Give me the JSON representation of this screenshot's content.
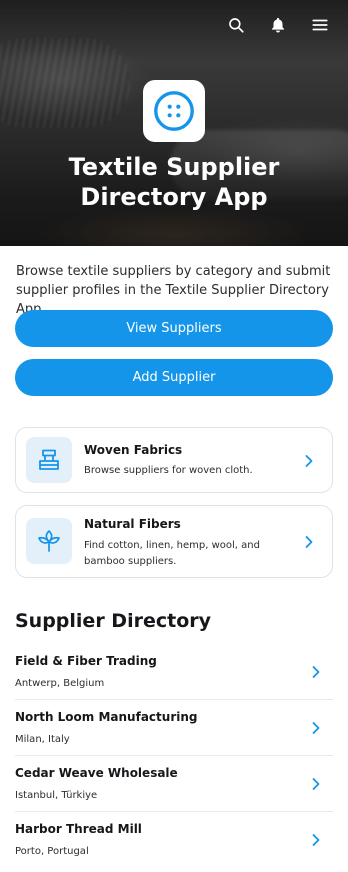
{
  "app": {
    "title": "Textile Supplier Directory App"
  },
  "header": {
    "icons": [
      "search-icon",
      "notification-bell-icon",
      "menu-icon"
    ]
  },
  "hero": {
    "title_line1": "Textile Supplier",
    "title_line2": "Directory App",
    "icon": "button-icon"
  },
  "intro": {
    "text": "Browse textile suppliers by category and submit supplier profiles in the Textile Supplier Directory App."
  },
  "actions": {
    "view_label": "View Suppliers",
    "add_label": "Add Supplier"
  },
  "categories": [
    {
      "title": "Woven Fabrics",
      "description": "Browse suppliers for woven cloth.",
      "icon": "loom-icon"
    },
    {
      "title": "Natural Fibers",
      "description": "Find cotton, linen, hemp, wool, and bamboo suppliers.",
      "icon": "leaf-icon"
    }
  ],
  "directory": {
    "heading": "Supplier Directory",
    "suppliers": [
      {
        "name": "Field & Fiber Trading",
        "location": "Antwerp, Belgium"
      },
      {
        "name": "North Loom Manufacturing",
        "location": "Milan, Italy"
      },
      {
        "name": "Cedar Weave Wholesale",
        "location": "Istanbul, Türkiye"
      },
      {
        "name": "Harbor Thread Mill",
        "location": "Porto, Portugal"
      }
    ]
  },
  "colors": {
    "accent": "#1495ea",
    "icon_bg": "#e3f0f9",
    "border": "#dfe3e8"
  }
}
